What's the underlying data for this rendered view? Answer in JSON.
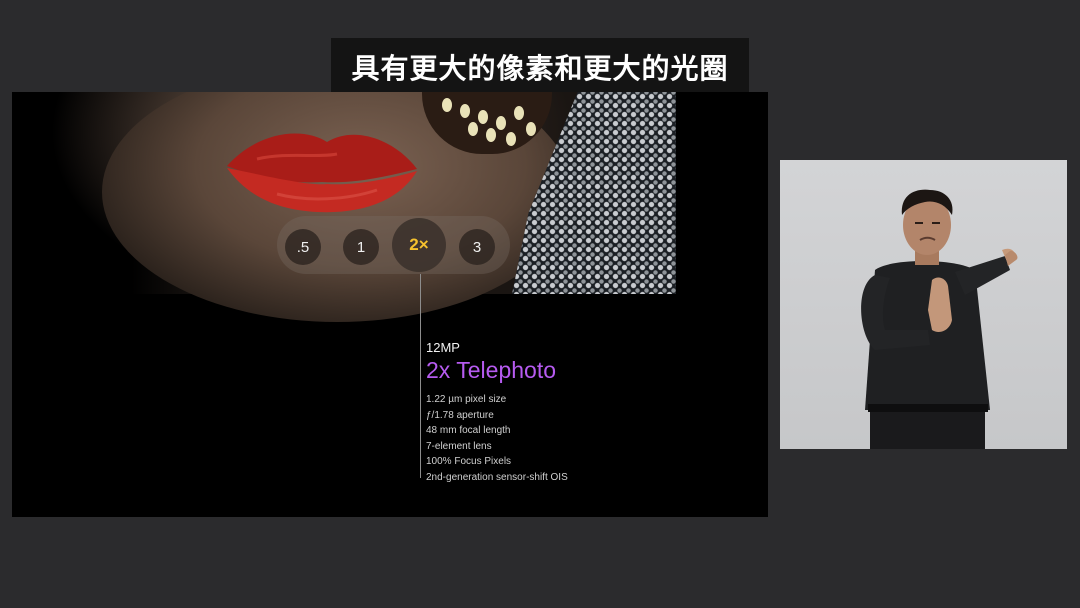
{
  "caption": {
    "text": "具有更大的像素和更大的光圈"
  },
  "slide": {
    "zoom_options": [
      ".5",
      "1",
      "2×",
      "3"
    ],
    "active_zoom": "2×",
    "sensor_label": "12MP",
    "lens_name": "2x Telephoto",
    "specs": [
      "1.22 µm pixel size",
      "ƒ/1.78 aperture",
      "48 mm focal length",
      "7-element lens",
      "100% Focus Pixels",
      "2nd-generation sensor-shift OIS"
    ]
  },
  "colors": {
    "accent_zoom": "#f5c12e",
    "lens_name": "#b65bf0",
    "lips": "#b5221c",
    "background": "#2b2b2d"
  }
}
